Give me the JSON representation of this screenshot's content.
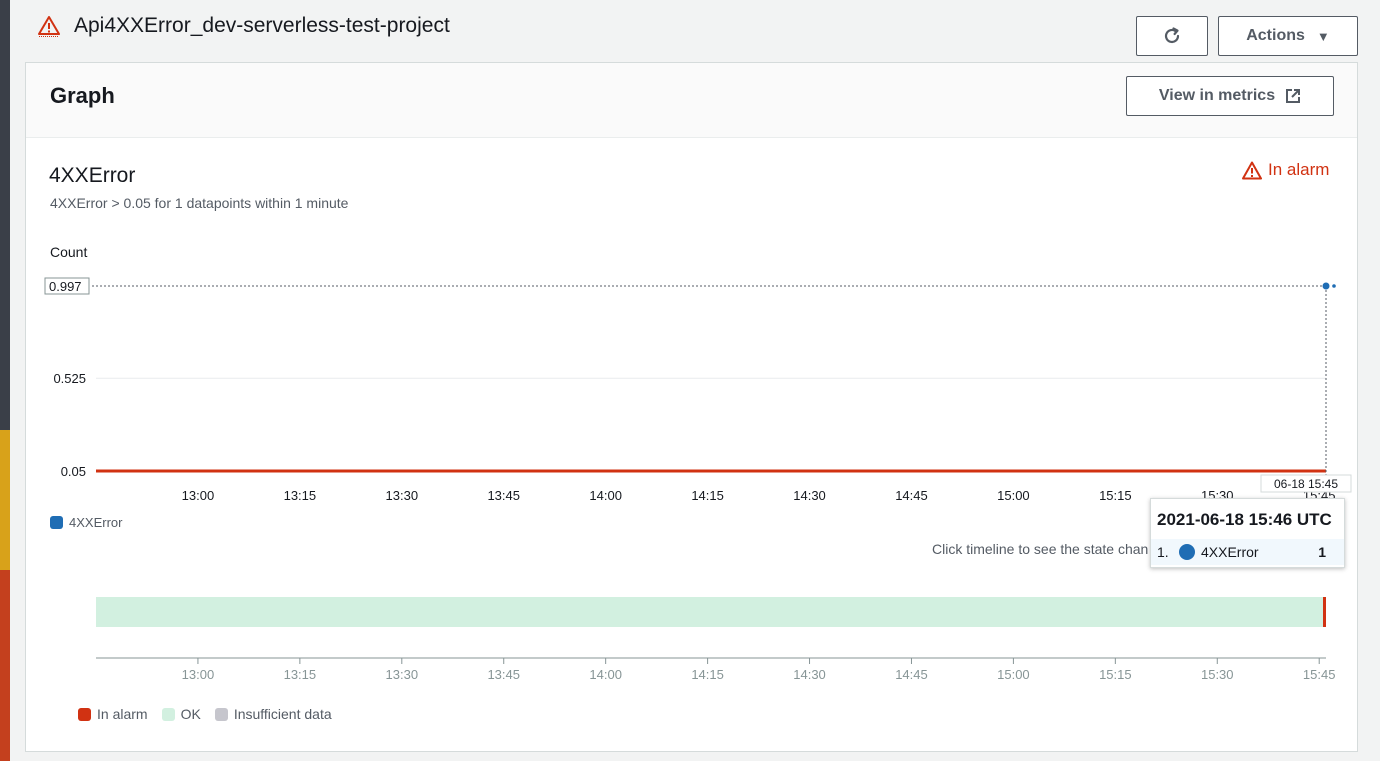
{
  "header": {
    "title": "Api4XXError_dev-serverless-test-project",
    "actions_label": "Actions",
    "refresh_icon": "refresh-icon",
    "warning_icon": "warning-triangle-icon"
  },
  "card": {
    "title": "Graph",
    "view_in_metrics_label": "View in metrics",
    "view_in_metrics_icon": "external-link-icon"
  },
  "metric": {
    "name": "4XXError",
    "description": "4XXError > 0.05 for 1 datapoints within 1 minute",
    "status": "In alarm"
  },
  "chart_data": {
    "type": "line",
    "ylabel": "Count",
    "ylim": [
      0.05,
      0.997
    ],
    "yticks": [
      {
        "value": 0.997,
        "label": "0.997"
      },
      {
        "value": 0.525,
        "label": "0.525"
      },
      {
        "value": 0.05,
        "label": "0.05"
      }
    ],
    "x_ticks": [
      "13:00",
      "13:15",
      "13:30",
      "13:45",
      "14:00",
      "14:15",
      "14:30",
      "14:45",
      "15:00",
      "15:15",
      "15:30",
      "15:45"
    ],
    "series": [
      {
        "name": "4XXError",
        "color": "#1f6db4",
        "points": [
          {
            "x": "15:46",
            "y": 1
          }
        ]
      }
    ],
    "threshold": {
      "value": 0.05,
      "color": "#d13212"
    },
    "cursor_label": "06-18 15:45",
    "legend": "bottom-left"
  },
  "tooltip": {
    "title": "2021-06-18 15:46 UTC",
    "rows": [
      {
        "index": "1.",
        "name": "4XXError",
        "value": "1"
      }
    ]
  },
  "timeline": {
    "hint": "Click timeline to see the state change",
    "x_ticks": [
      "13:00",
      "13:15",
      "13:30",
      "13:45",
      "14:00",
      "14:15",
      "14:30",
      "14:45",
      "15:00",
      "15:15",
      "15:30",
      "15:45"
    ],
    "legend": [
      {
        "label": "In alarm",
        "color": "#d13212"
      },
      {
        "label": "OK",
        "color": "#d2f0e0"
      },
      {
        "label": "Insufficient data",
        "color": "#c6c6cd"
      }
    ]
  }
}
